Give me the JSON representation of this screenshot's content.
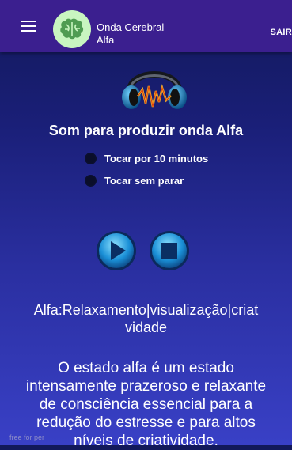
{
  "app_bar": {
    "title_line1": "Onda Cerebral",
    "title_line2": "Alfa",
    "action_label": "SAIR",
    "background": "#3b1f8f"
  },
  "main": {
    "heading": "Som para produzir onda Alfa",
    "options": [
      {
        "label": "Tocar por 10 minutos",
        "selected": false
      },
      {
        "label": "Tocar sem parar",
        "selected": false
      }
    ],
    "controls": [
      "play-icon",
      "stop-icon"
    ],
    "subtitle_line1": "Alfa:Relaxamento|visualização|criat",
    "subtitle_line2": "vidade",
    "description_lines": [
      "O estado alfa é um estado",
      "intensamente prazeroso e relaxante",
      "de consciência essencial para a",
      "redução do estresse e para altos",
      "níveis de criatividade."
    ],
    "watermark": "free for per"
  }
}
